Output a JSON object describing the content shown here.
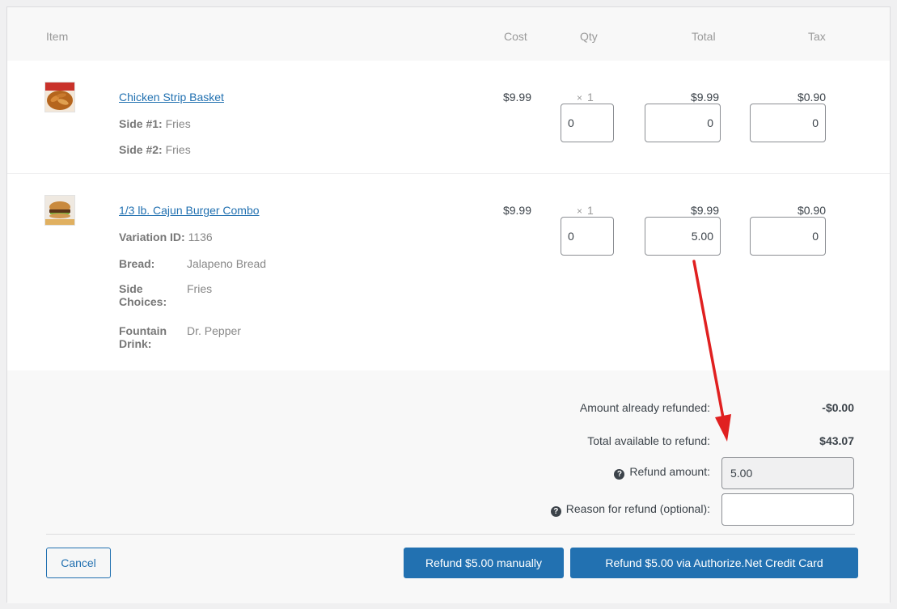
{
  "columns": {
    "item": "Item",
    "cost": "Cost",
    "qty": "Qty",
    "total": "Total",
    "tax": "Tax"
  },
  "items": [
    {
      "name": "Chicken Strip Basket",
      "icon": "food-thumbnail-icon",
      "meta": [
        {
          "key": "Side #1:",
          "value": "Fries"
        },
        {
          "key": "Side #2:",
          "value": "Fries"
        }
      ],
      "cost": "$9.99",
      "qty_times": "×",
      "qty": "1",
      "total": "$9.99",
      "tax": "$0.90",
      "refund_qty": "0",
      "refund_total": "0",
      "refund_tax": "0"
    },
    {
      "name": "1/3 lb. Cajun Burger Combo",
      "icon": "food-thumbnail-icon",
      "variation_label": "Variation ID:",
      "variation_id": "1136",
      "meta": [
        {
          "key": "Bread:",
          "value": "Jalapeno Bread"
        },
        {
          "key": "Side Choices:",
          "value": "Fries"
        },
        {
          "key": "Fountain Drink:",
          "value": "Dr. Pepper"
        }
      ],
      "cost": "$9.99",
      "qty_times": "×",
      "qty": "1",
      "total": "$9.99",
      "tax": "$0.90",
      "refund_qty": "0",
      "refund_total": "5.00",
      "refund_tax": "0"
    }
  ],
  "summary": {
    "already_refunded_label": "Amount already refunded:",
    "already_refunded_value": "-$0.00",
    "available_label": "Total available to refund:",
    "available_value": "$43.07",
    "refund_amount_label": "Refund amount:",
    "refund_amount_value": "5.00",
    "reason_label": "Reason for refund (optional):",
    "reason_value": "",
    "help_icon": "question-circle-icon"
  },
  "buttons": {
    "cancel": "Cancel",
    "refund_manual": "Refund $5.00 manually",
    "refund_gateway": "Refund $5.00 via Authorize.Net Credit Card"
  },
  "colors": {
    "link": "#2271b1",
    "primary": "#2271b1",
    "annotation_arrow": "#e02020"
  }
}
